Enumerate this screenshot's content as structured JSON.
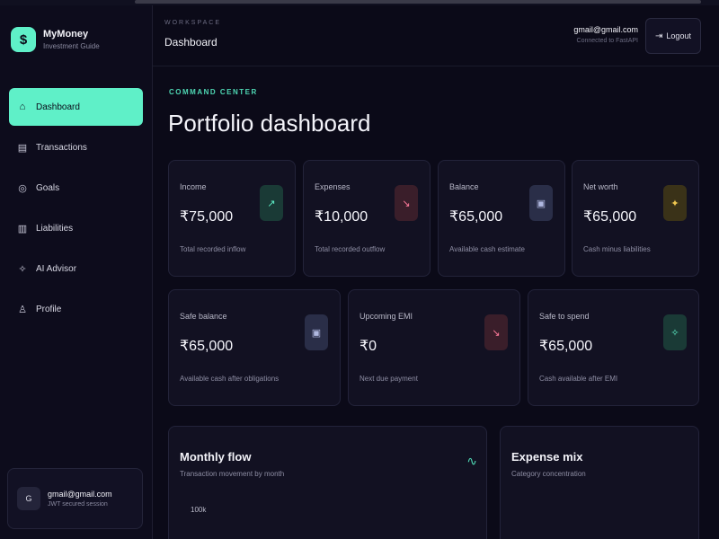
{
  "brand": {
    "name": "MyMoney",
    "subtitle": "Investment Guide",
    "logo_icon": "rupee-coin-icon"
  },
  "nav": {
    "items": [
      {
        "label": "Dashboard",
        "icon": "home-icon",
        "active": true
      },
      {
        "label": "Transactions",
        "icon": "receipt-icon"
      },
      {
        "label": "Goals",
        "icon": "target-icon"
      },
      {
        "label": "Liabilities",
        "icon": "bank-icon"
      },
      {
        "label": "AI Advisor",
        "icon": "sparkle-icon"
      },
      {
        "label": "Profile",
        "icon": "user-icon"
      }
    ]
  },
  "sidebar_user": {
    "initial": "G",
    "email": "gmail@gmail.com",
    "subtitle": "JWT secured session"
  },
  "header": {
    "kicker": "WORKSPACE",
    "title": "Dashboard",
    "user_email": "gmail@gmail.com",
    "user_sub": "Connected to FastAPI",
    "logout_label": "Logout"
  },
  "page": {
    "kicker": "COMMAND CENTER",
    "title": "Portfolio dashboard"
  },
  "stats_row1": [
    {
      "label": "Income",
      "value": "₹75,000",
      "sub": "Total recorded inflow",
      "icon": "trend-up-icon",
      "tone": "green"
    },
    {
      "label": "Expenses",
      "value": "₹10,000",
      "sub": "Total recorded outflow",
      "icon": "trend-down-icon",
      "tone": "red"
    },
    {
      "label": "Balance",
      "value": "₹65,000",
      "sub": "Available cash estimate",
      "icon": "wallet-icon",
      "tone": "blue"
    },
    {
      "label": "Net worth",
      "value": "₹65,000",
      "sub": "Cash minus liabilities",
      "icon": "star-icon",
      "tone": "gold"
    }
  ],
  "stats_row2": [
    {
      "label": "Safe balance",
      "value": "₹65,000",
      "sub": "Available cash after obligations",
      "icon": "wallet-icon",
      "tone": "blue"
    },
    {
      "label": "Upcoming EMI",
      "value": "₹0",
      "sub": "Next due payment",
      "icon": "trend-down-icon",
      "tone": "red"
    },
    {
      "label": "Safe to spend",
      "value": "₹65,000",
      "sub": "Cash available after EMI",
      "icon": "sparkle-icon",
      "tone": "green"
    }
  ],
  "panels": {
    "monthly": {
      "title": "Monthly flow",
      "subtitle": "Transaction movement by month",
      "y_tick": "100k",
      "icon": "pulse-icon"
    },
    "expense": {
      "title": "Expense mix",
      "subtitle": "Category concentration"
    }
  }
}
